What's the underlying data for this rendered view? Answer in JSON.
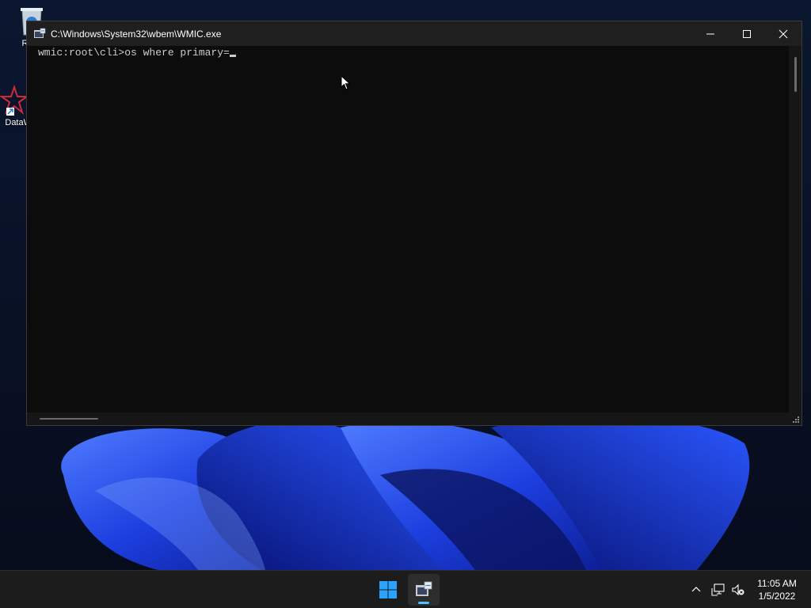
{
  "desktop": {
    "icons": [
      {
        "label": "Recy",
        "icon": "recycle-bin-icon"
      },
      {
        "label": "DataW",
        "icon": "datawedge-icon"
      }
    ]
  },
  "window": {
    "title": "C:\\Windows\\System32\\wbem\\WMIC.exe",
    "console_line": "wmic:root\\cli>os where primary=",
    "buttons": {
      "minimize": "minimize-icon",
      "maximize": "maximize-icon",
      "close": "close-icon"
    }
  },
  "taskbar": {
    "apps": [
      {
        "icon": "windows-start-icon"
      },
      {
        "icon": "wmic-console-icon",
        "active": true
      }
    ],
    "tray": [
      "chevron-up-icon",
      "network-icon",
      "volume-muted-icon"
    ],
    "clock": {
      "time": "11:05 AM",
      "date": "1/5/2022"
    }
  },
  "colors": {
    "accent": "#4cc2ff",
    "console_bg": "#0c0c0c",
    "titlebar_bg": "#1f1f1f",
    "taskbar_bg": "#1c1c1c",
    "wallpaper_blue": "#1a4cff"
  }
}
